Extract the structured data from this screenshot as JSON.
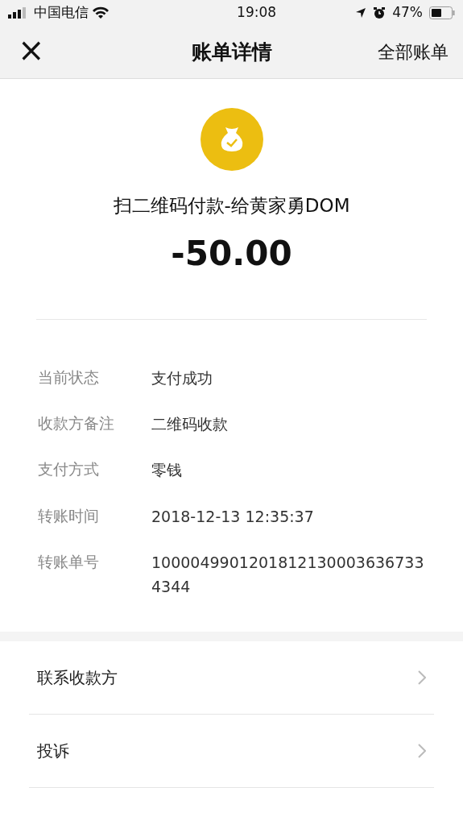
{
  "status_bar": {
    "carrier": "中国电信",
    "time": "19:08",
    "battery": "47%"
  },
  "nav": {
    "close": "×",
    "title": "账单详情",
    "action": "全部账单"
  },
  "summary": {
    "title": "扫二维码付款-给黄家勇DOM",
    "amount": "-50.00"
  },
  "details": [
    {
      "label": "当前状态",
      "value": "支付成功"
    },
    {
      "label": "收款方备注",
      "value": "二维码收款"
    },
    {
      "label": "支付方式",
      "value": "零钱"
    },
    {
      "label": "转账时间",
      "value": "2018-12-13 12:35:37"
    },
    {
      "label": "转账单号",
      "value": "10000499012018121300036367334344"
    }
  ],
  "menu": [
    "联系收款方",
    "投诉"
  ]
}
